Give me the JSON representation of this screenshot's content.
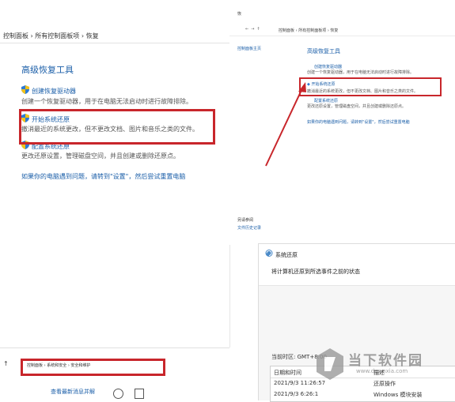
{
  "left": {
    "breadcrumb": [
      "控制面板",
      "所有控制面板项",
      "恢复"
    ],
    "heading": "高级恢复工具",
    "item1_title": "创建恢复驱动器",
    "item1_desc": "创建一个恢复驱动器，用于在电脑无法启动时进行故障排除。",
    "item2_title": "开始系统还原",
    "item2_desc": "撤消最近的系统更改，但不更改文档、图片和音乐之类的文件。",
    "item3_title": "配置系统还原",
    "item3_desc": "更改还原设置，管理磁盘空间，并且创建或删除还原点。",
    "reset_link": "如果你的电脑遇到问题，请转到\"设置\"，然后尝试重置电脑",
    "bottom_breadcrumb": [
      "控制面板",
      "系统和安全",
      "安全和维护"
    ],
    "bottom_text": "查看最新消息并解"
  },
  "right": {
    "title_bar": "恢",
    "breadcrumb": [
      "控制面板",
      "所有控制面板项",
      "恢复"
    ],
    "sidebar_link": "控制面板主页",
    "heading": "高级恢复工具",
    "item1_title": "创建恢复驱动器",
    "item1_desc": "创建一个恢复驱动器，用于在电脑无法启动时进行故障排除。",
    "item2_title": "开始系统还原",
    "item2_desc": "撤消最近的系统更改，但不更改文档、图片和音乐之类的文件。",
    "item3_title": "配置系统还原",
    "item3_desc": "更改还原设置，管理磁盘空间，并且创建或删除还原点。",
    "reset_link": "如果你的电脑遇到问题，请转到\"设置\"，然后尝试重置电脑",
    "see_also": "另请参阅",
    "file_history": "文件历史记录"
  },
  "restore_dialog": {
    "title": "系统还原",
    "subtitle": "将计算机还原到所选事件之前的状态",
    "timezone": "当前时区: GMT+8:00",
    "col_date": "日期和时间",
    "col_desc": "描述",
    "row1_date": "2021/9/3 11:26:57",
    "row1_desc": "还原操作",
    "row2_date": "2021/9/3 6:26:1",
    "row2_desc": "Windows 模块安装"
  },
  "watermark": {
    "name": "当下软件园",
    "url": "www.downxia.com"
  },
  "colors": {
    "accent_red": "#c8262b",
    "link_blue": "#1a5ea8"
  }
}
